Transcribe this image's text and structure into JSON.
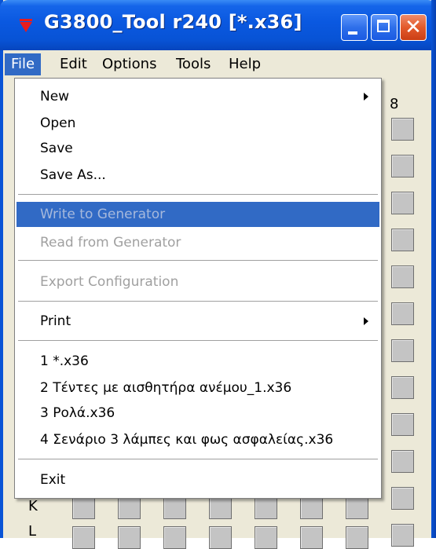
{
  "window": {
    "title": "G3800_Tool r240 [*.x36]",
    "app_icon": "red-triangle-icon",
    "buttons": {
      "minimize": "minimize-icon",
      "maximize": "maximize-icon",
      "close": "close-icon",
      "close_glyph": "✕"
    }
  },
  "menubar": {
    "items": [
      "File",
      "Edit",
      "Options",
      "Tools",
      "Help"
    ],
    "active": "File"
  },
  "grid": {
    "column_header": "8",
    "row_label_partial": "K",
    "row_label_partial_2": "L"
  },
  "file_menu": {
    "items": [
      {
        "label": "New",
        "submenu": true
      },
      {
        "label": "Open"
      },
      {
        "label": "Save"
      },
      {
        "label": "Save As..."
      },
      {
        "label": "Write to Generator",
        "disabled": true,
        "highlighted": true
      },
      {
        "label": "Read from Generator",
        "disabled": true
      },
      {
        "label": "Export Configuration",
        "disabled": true
      },
      {
        "label": "Print",
        "submenu": true
      },
      {
        "label": "1 *.x36"
      },
      {
        "label": "2 Τέντες με αισθητήρα ανέμου_1.x36"
      },
      {
        "label": "3 Ρολά.x36"
      },
      {
        "label": "4 Σενάριο 3 λάμπες και φως ασφαλείας.x36"
      },
      {
        "label": "Exit"
      }
    ]
  },
  "colors": {
    "titlebar": "#0a58e0",
    "menu_highlight": "#316ac5",
    "disabled_text": "#a0a0a0"
  }
}
